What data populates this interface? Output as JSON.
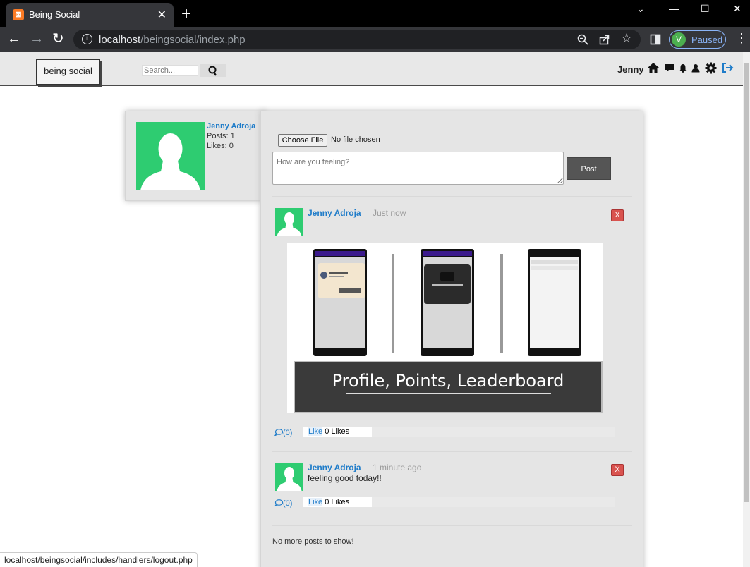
{
  "browser": {
    "tab_title": "Being Social",
    "url_host": "localhost",
    "url_path": "/beingsocial/index.php",
    "profile_initial": "V",
    "profile_status": "Paused"
  },
  "site": {
    "logo_text": "being social",
    "search_placeholder": "Search...",
    "nav_username": "Jenny"
  },
  "profile_card": {
    "name": "Jenny Adroja",
    "posts_label": "Posts: 1",
    "likes_label": "Likes: 0"
  },
  "composer": {
    "file_button": "Choose File",
    "file_status": "No file chosen",
    "placeholder": "How are you feeling?",
    "post_button": "Post"
  },
  "posts": [
    {
      "author": "Jenny Adroja",
      "time": "Just now",
      "delete_label": "X",
      "image_caption": "Profile, Points, Leaderboard",
      "comments_label": "(0)",
      "like_label": "Like",
      "likes_label": "0 Likes"
    },
    {
      "author": "Jenny Adroja",
      "time": "1 minute ago",
      "body": "feeling good today!!",
      "delete_label": "X",
      "comments_label": "(0)",
      "like_label": "Like",
      "likes_label": "0 Likes"
    }
  ],
  "feed_end_text": "No more posts to show!",
  "status_bar_url": "localhost/beingsocial/includes/handlers/logout.php",
  "colors": {
    "link_blue": "#1f7cc9",
    "avatar_green": "#2ecc71",
    "delete_red": "#d9534f"
  }
}
